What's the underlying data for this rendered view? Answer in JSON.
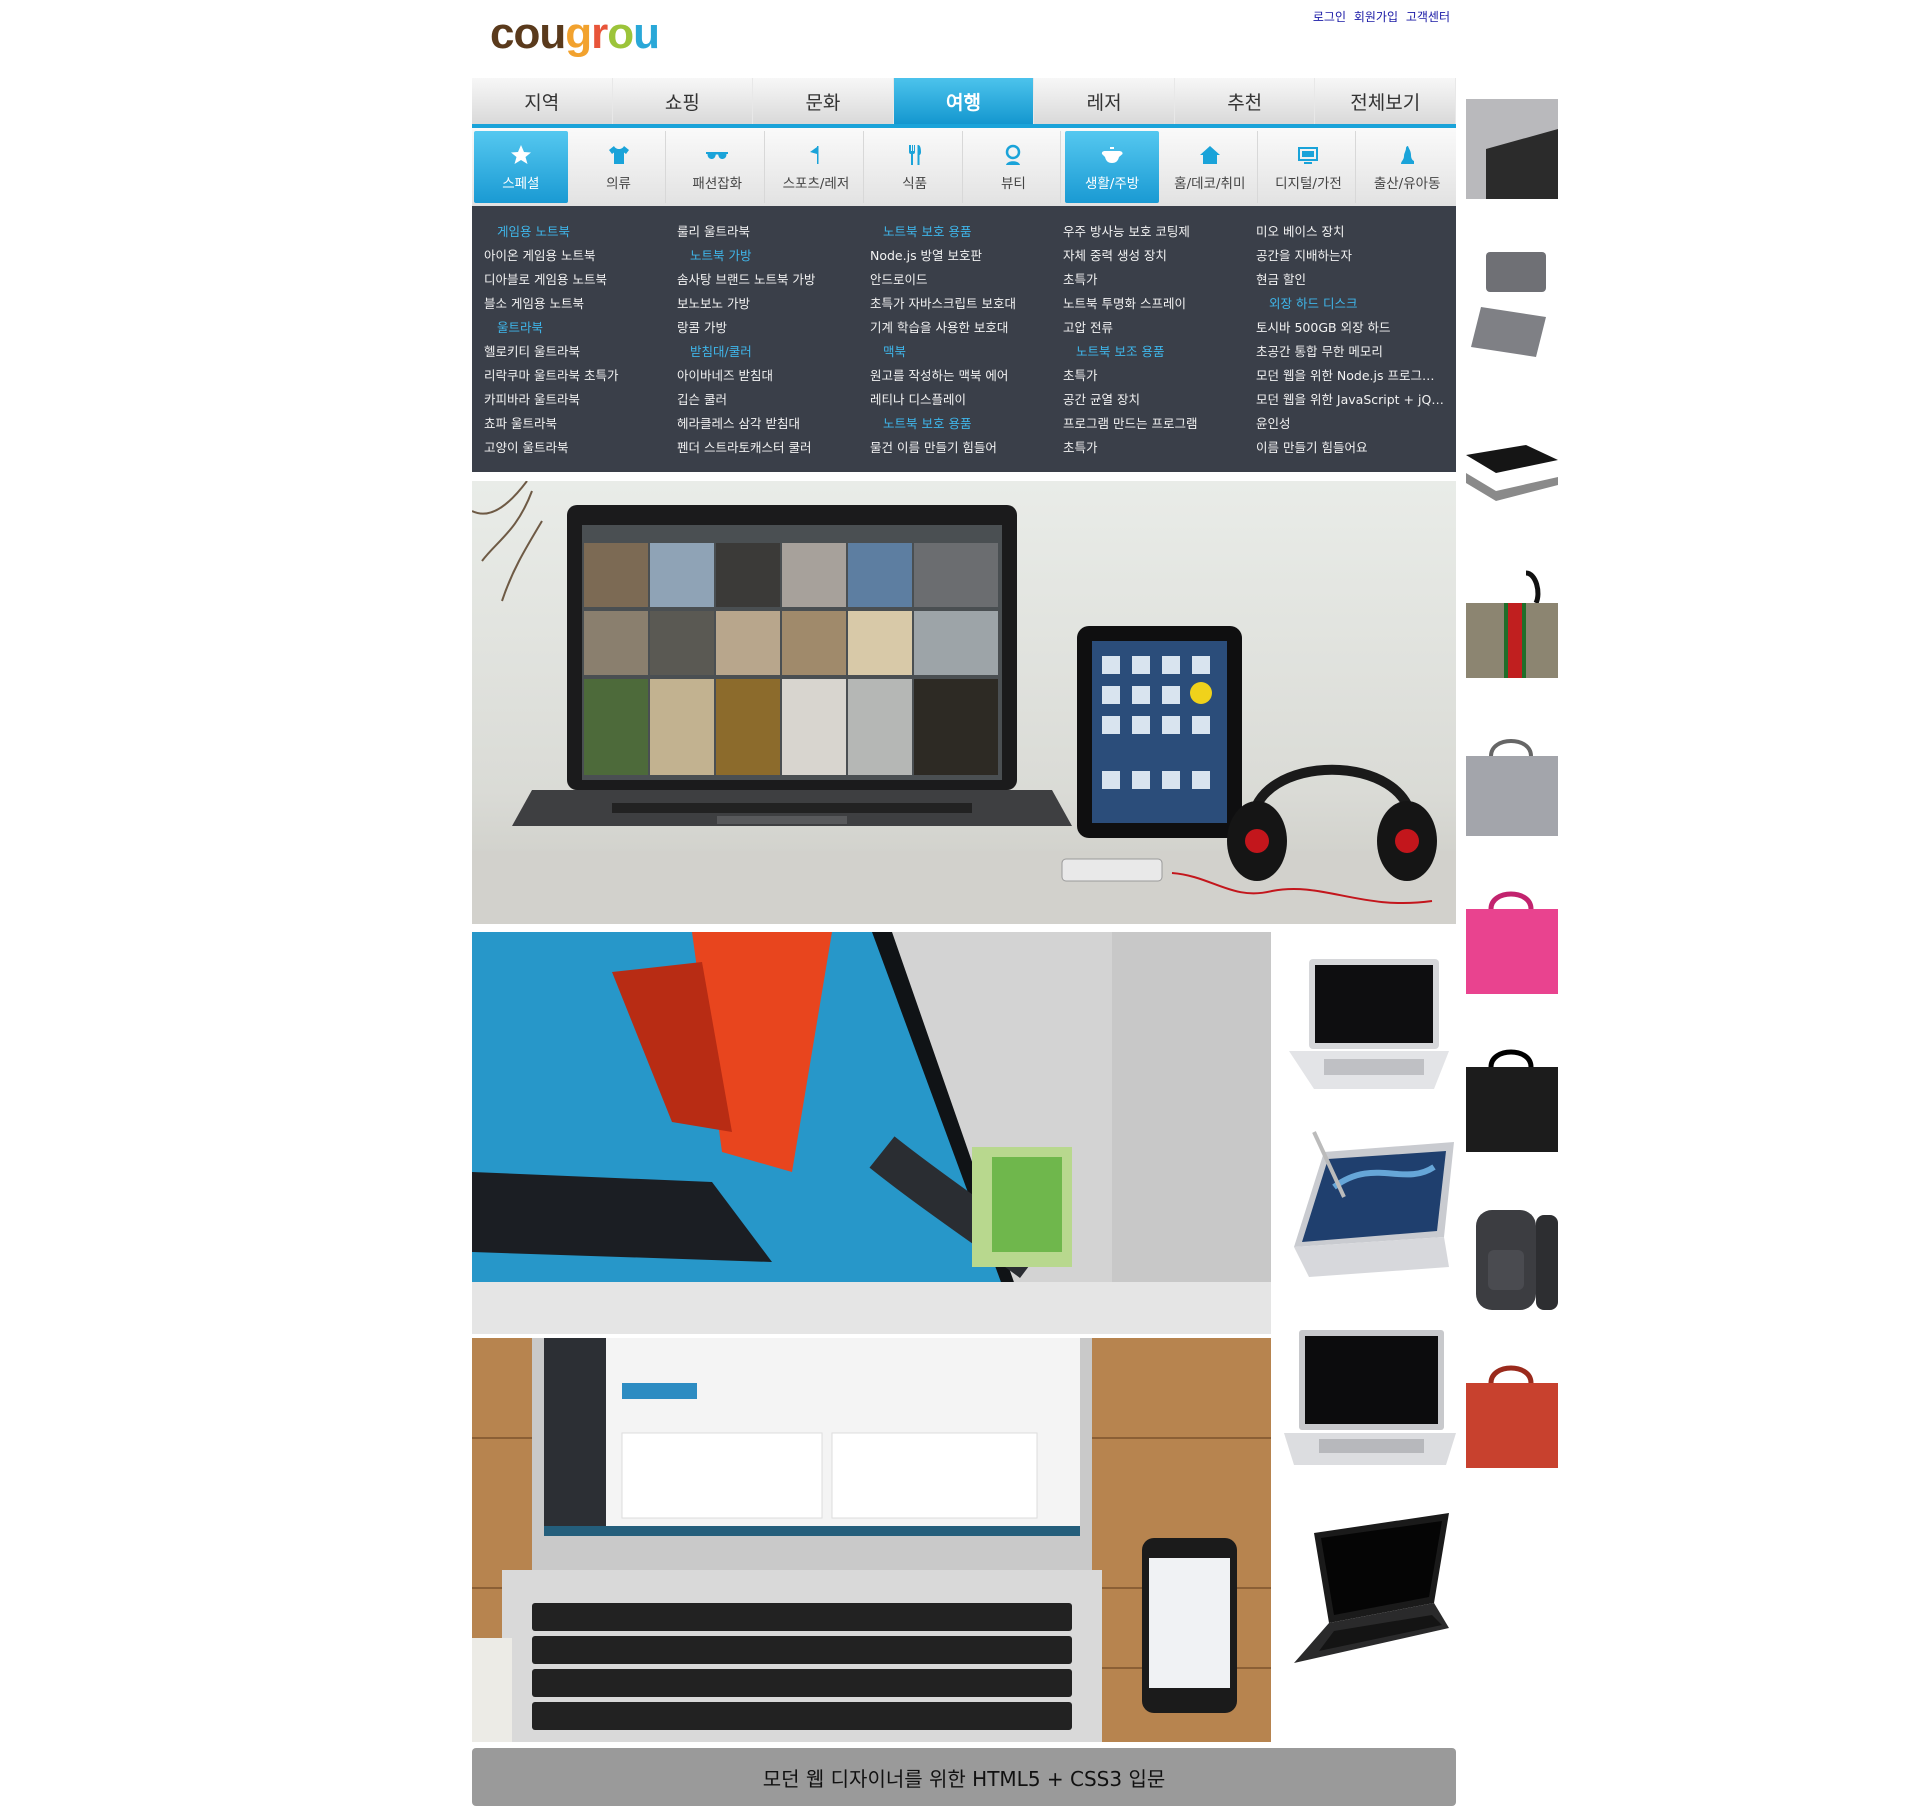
{
  "brand": {
    "logo_text": "cougrou",
    "colors": {
      "accent": "#1aa3d9",
      "menu_bg": "#3a3f49",
      "menu_heading": "#3fb6ea",
      "footer_bg": "#9a9a9a"
    }
  },
  "top_links": [
    "로그인",
    "회원가입",
    "고객센터"
  ],
  "main_tabs": [
    {
      "label": "지역",
      "active": false
    },
    {
      "label": "쇼핑",
      "active": false
    },
    {
      "label": "문화",
      "active": false
    },
    {
      "label": "여행",
      "active": true
    },
    {
      "label": "레저",
      "active": false
    },
    {
      "label": "추천",
      "active": false
    },
    {
      "label": "전체보기",
      "active": false
    }
  ],
  "sub_categories": [
    {
      "label": "스페셜",
      "icon": "star-icon",
      "active": true
    },
    {
      "label": "의류",
      "icon": "shirt-icon",
      "active": false
    },
    {
      "label": "패션잡화",
      "icon": "sunglasses-icon",
      "active": false
    },
    {
      "label": "스포츠/레저",
      "icon": "flag-icon",
      "active": false
    },
    {
      "label": "식품",
      "icon": "cutlery-icon",
      "active": false
    },
    {
      "label": "뷰티",
      "icon": "person-icon",
      "active": false
    },
    {
      "label": "생활/주방",
      "icon": "teapot-icon",
      "active": true
    },
    {
      "label": "홈/데코/취미",
      "icon": "home-icon",
      "active": false
    },
    {
      "label": "디지털/가전",
      "icon": "tv-icon",
      "active": false
    },
    {
      "label": "출산/유아동",
      "icon": "baby-icon",
      "active": false
    }
  ],
  "mega_menu": {
    "columns": [
      [
        {
          "text": "게임용 노트북",
          "heading": true
        },
        {
          "text": "아이온 게임용 노트북",
          "heading": false
        },
        {
          "text": "디아블로 게임용 노트북",
          "heading": false
        },
        {
          "text": "블소 게임용 노트북",
          "heading": false
        },
        {
          "text": "울트라북",
          "heading": true
        },
        {
          "text": "헬로키티 울트라북",
          "heading": false
        },
        {
          "text": "리락쿠마 울트라북 초특가",
          "heading": false
        },
        {
          "text": "카피바라 울트라북",
          "heading": false
        },
        {
          "text": "쵸파 울트라북",
          "heading": false
        },
        {
          "text": "고양이 울트라북",
          "heading": false
        }
      ],
      [
        {
          "text": "룰리 울트라북",
          "heading": false
        },
        {
          "text": "노트북 가방",
          "heading": true
        },
        {
          "text": "솜사탕 브랜드 노트북 가방",
          "heading": false
        },
        {
          "text": "보노보노 가방",
          "heading": false
        },
        {
          "text": "랑콤 가방",
          "heading": false
        },
        {
          "text": "받침대/쿨러",
          "heading": true
        },
        {
          "text": "아이바네즈 받침대",
          "heading": false
        },
        {
          "text": "깁슨 쿨러",
          "heading": false
        },
        {
          "text": "헤라클레스 삼각 받침대",
          "heading": false
        },
        {
          "text": "펜더 스트라토캐스터 쿨러",
          "heading": false
        }
      ],
      [
        {
          "text": "노트북 보호 용품",
          "heading": true
        },
        {
          "text": "Node.js 방열 보호판",
          "heading": false
        },
        {
          "text": "안드로이드",
          "heading": false
        },
        {
          "text": "초특가 자바스크립트 보호대",
          "heading": false
        },
        {
          "text": "기계 학습을 사용한 보호대",
          "heading": false
        },
        {
          "text": "맥북",
          "heading": true
        },
        {
          "text": "원고를 작성하는 맥북 에어",
          "heading": false
        },
        {
          "text": "레티나 디스플레이",
          "heading": false
        },
        {
          "text": "노트북 보호 용품",
          "heading": true
        },
        {
          "text": "물건 이름 만들기 힘들어",
          "heading": false
        }
      ],
      [
        {
          "text": "우주 방사능 보호 코팅제",
          "heading": false
        },
        {
          "text": "자체 중력 생성 장치",
          "heading": false
        },
        {
          "text": "초특가",
          "heading": false
        },
        {
          "text": "노트북 투명화 스프레이",
          "heading": false
        },
        {
          "text": "고압 전류",
          "heading": false
        },
        {
          "text": "노트북 보조 용품",
          "heading": true
        },
        {
          "text": "초특가",
          "heading": false
        },
        {
          "text": "공간 균열 장치",
          "heading": false
        },
        {
          "text": "프로그램 만드는 프로그램",
          "heading": false
        },
        {
          "text": "초특가",
          "heading": false
        }
      ],
      [
        {
          "text": "미오 베이스 장치",
          "heading": false
        },
        {
          "text": "공간을 지배하는자",
          "heading": false
        },
        {
          "text": "현금 할인",
          "heading": false
        },
        {
          "text": "외장 하드 디스크",
          "heading": true
        },
        {
          "text": "토시바 500GB 외장 하드",
          "heading": false
        },
        {
          "text": "초공간 통합 무한 메모리",
          "heading": false
        },
        {
          "text": "모던 웹을 위한 Node.js 프로그래밍",
          "heading": false
        },
        {
          "text": "모던 웹을 위한 JavaScript + jQuery 입문",
          "heading": false
        },
        {
          "text": "윤인성",
          "heading": false
        },
        {
          "text": "이름 만들기 힘들어요",
          "heading": false
        }
      ]
    ]
  },
  "photos": {
    "hero": "laptop-tablet-headphones-photo",
    "left_middle": "imac-closeup-photo",
    "left_bottom": "macbook-air-wordpress-photo"
  },
  "laptop_list": [
    {
      "name": "silver-laptop-image"
    },
    {
      "name": "convertible-laptop-pen-image"
    },
    {
      "name": "slim-laptop-image"
    },
    {
      "name": "netbook-image"
    }
  ],
  "bag_strip": [
    {
      "name": "felt-sleeve-image",
      "color": "#b9b9bc"
    },
    {
      "name": "gray-pouch-image",
      "color": "#6f7075"
    },
    {
      "name": "black-hardcase-image",
      "color": "#151515"
    },
    {
      "name": "pattern-briefcase-image",
      "color": "#8c8571"
    },
    {
      "name": "gray-messenger-bag-image",
      "color": "#a3a5ab"
    },
    {
      "name": "pink-laptop-bag-image",
      "color": "#e9438f"
    },
    {
      "name": "black-laptop-bag-image",
      "color": "#1c1c1c"
    },
    {
      "name": "gray-backpack-image",
      "color": "#3c3d41"
    },
    {
      "name": "red-laptop-bag-image",
      "color": "#c8412e"
    }
  ],
  "footer": {
    "text": "모던 웹 디자이너를 위한 HTML5 + CSS3 입문"
  }
}
